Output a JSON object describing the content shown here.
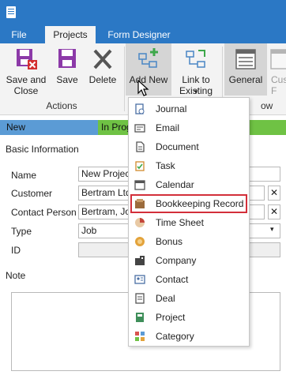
{
  "tabs": [
    {
      "label": "File",
      "active": false
    },
    {
      "label": "Projects",
      "active": true
    },
    {
      "label": "Form Designer",
      "active": false
    }
  ],
  "ribbon": {
    "save_close": "Save and Close",
    "save": "Save",
    "delete": "Delete",
    "add_new": "Add New",
    "link_existing": "Link to Existing",
    "general": "General",
    "cust_partial": "Cus F",
    "group_actions": "Actions",
    "group_view_partial": "ow"
  },
  "status": {
    "new": "New",
    "in_progress_partial": "In Prog"
  },
  "form": {
    "section_title": "Basic Information",
    "name_label": "Name",
    "name_value": "New Project",
    "customer_label": "Customer",
    "customer_value": "Bertram Ltd.",
    "contact_label": "Contact Person",
    "contact_value": "Bertram, Joh",
    "type_label": "Type",
    "type_value": "Job",
    "id_label": "ID",
    "note_label": "Note"
  },
  "menu": {
    "items": [
      {
        "label": "Journal",
        "icon": "journal-icon"
      },
      {
        "label": "Email",
        "icon": "email-icon"
      },
      {
        "label": "Document",
        "icon": "document-icon"
      },
      {
        "label": "Task",
        "icon": "task-icon"
      },
      {
        "label": "Calendar",
        "icon": "calendar-icon"
      },
      {
        "label": "Bookkeeping Record",
        "icon": "bookkeeping-icon",
        "highlighted": true
      },
      {
        "label": "Time Sheet",
        "icon": "time-sheet-icon"
      },
      {
        "label": "Bonus",
        "icon": "bonus-icon"
      },
      {
        "label": "Company",
        "icon": "company-icon"
      },
      {
        "label": "Contact",
        "icon": "contact-icon"
      },
      {
        "label": "Deal",
        "icon": "deal-icon"
      },
      {
        "label": "Project",
        "icon": "project-icon"
      },
      {
        "label": "Category",
        "icon": "category-icon"
      }
    ]
  },
  "colors": {
    "accent": "#2b78c5",
    "status_new": "#5b9bd5",
    "status_progress": "#6fc244",
    "highlight": "#d32f3a"
  }
}
